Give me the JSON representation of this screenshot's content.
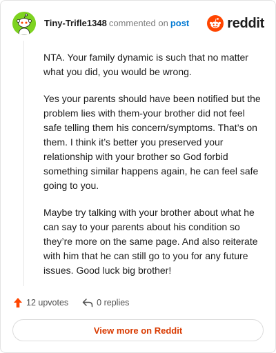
{
  "header": {
    "username": "Tiny-Trifle1348",
    "action_text": "commented on",
    "post_link": "post",
    "brand": "reddit",
    "avatar_color": "#7ed321",
    "brand_color": "#ff4500"
  },
  "comment": {
    "paragraphs": [
      "NTA. Your family dynamic is such that no matter what you did, you would be wrong.",
      "Yes your parents should have been notified but the problem lies with them-your brother did not feel safe telling them his concern/symptoms. That’s on them. I think it’s better you preserved your relationship with your brother so God forbid something similar happens again, he can feel safe going to you.",
      "Maybe try talking with your brother about what he can say to your parents about his condition so they’re more on the same page. And also reiterate with him that he can still go to you for any future issues. Good luck big brother!"
    ]
  },
  "actions": {
    "upvotes_label": "12 upvotes",
    "replies_label": "0 replies",
    "upvote_icon": "upvote-arrow-icon",
    "reply_icon": "reply-arrow-icon",
    "upvote_color": "#ff4500"
  },
  "footer": {
    "view_more_label": "View more on Reddit",
    "view_more_color": "#d93a00"
  }
}
